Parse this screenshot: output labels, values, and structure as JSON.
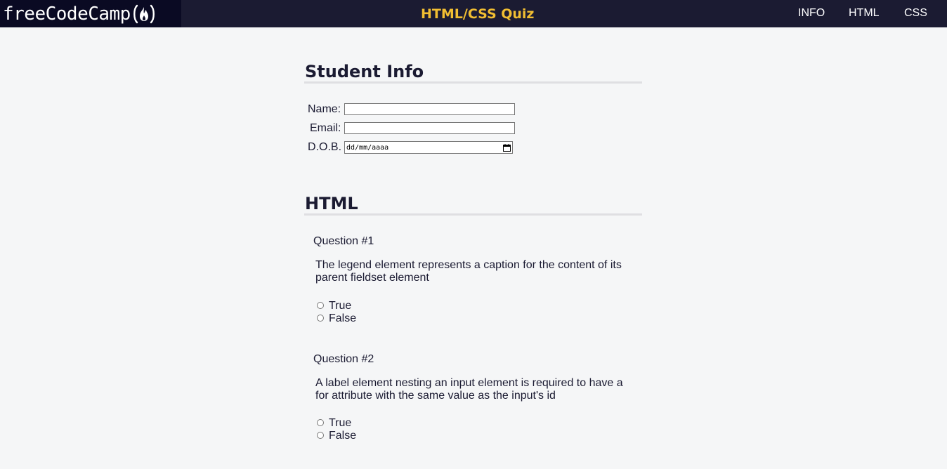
{
  "header": {
    "logo_text": "freeCodeCamp",
    "logo_icon": "fire-icon",
    "title": "HTML/CSS Quiz",
    "nav": [
      "INFO",
      "HTML",
      "CSS"
    ]
  },
  "student_info": {
    "heading": "Student Info",
    "name_label": "Name:",
    "email_label": "Email:",
    "dob_label": "D.O.B.",
    "name_value": "",
    "email_value": "",
    "dob_placeholder": "dd/mm/aaaa"
  },
  "html_section": {
    "heading": "HTML",
    "questions": [
      {
        "title": "Question #1",
        "text": "The legend element represents a caption for the content of its parent fieldset element",
        "options": [
          "True",
          "False"
        ]
      },
      {
        "title": "Question #2",
        "text": "A label element nesting an input element is required to have a for attribute with the same value as the input's id",
        "options": [
          "True",
          "False"
        ]
      }
    ]
  },
  "colors": {
    "header_bg": "#1b1b32",
    "logo_bg": "#0a0a23",
    "accent": "#f1be32",
    "page_bg": "#f5f6f7"
  }
}
